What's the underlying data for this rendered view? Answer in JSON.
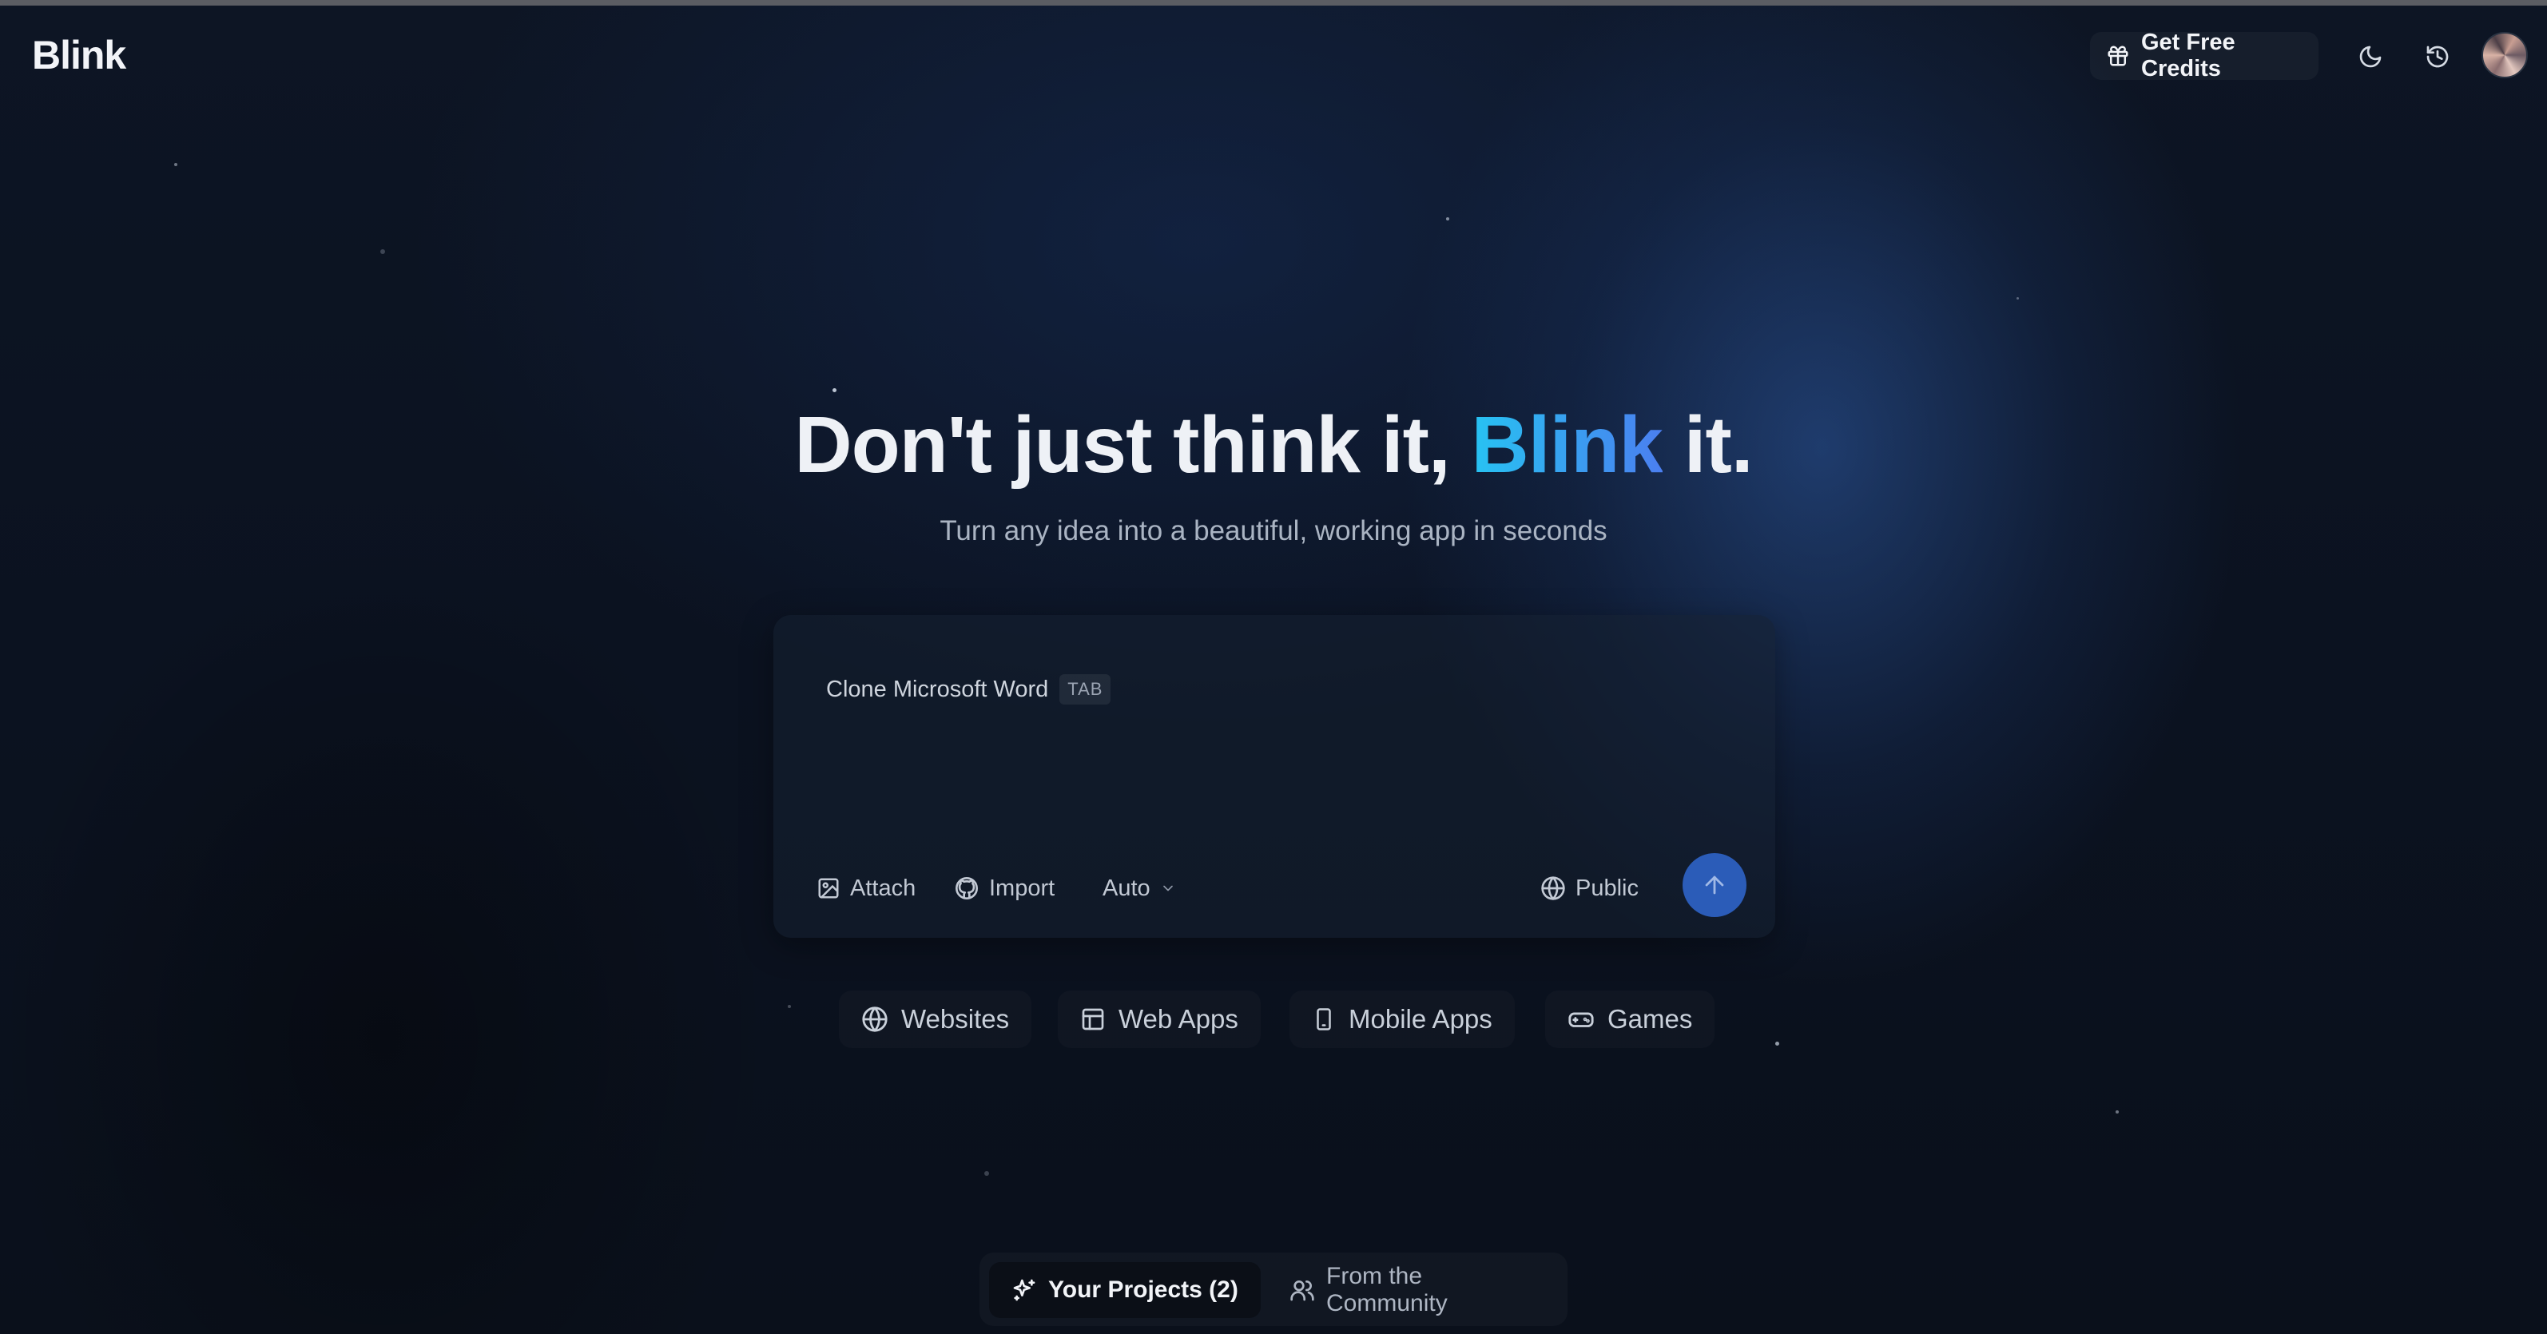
{
  "header": {
    "logo": "Blink",
    "credits_label": "Get Free Credits"
  },
  "hero": {
    "title_before": "Don't just think it, ",
    "title_brand": "Blink",
    "title_after": " it.",
    "subtitle": "Turn any idea into a beautiful, working app in seconds"
  },
  "prompt": {
    "suggestion": "Clone Microsoft Word",
    "tab_hint": "TAB",
    "attach_label": "Attach",
    "import_label": "Import",
    "model_label": "Auto",
    "visibility_label": "Public"
  },
  "categories": [
    {
      "label": "Websites",
      "icon": "globe-icon"
    },
    {
      "label": "Web Apps",
      "icon": "layout-icon"
    },
    {
      "label": "Mobile Apps",
      "icon": "smartphone-icon"
    },
    {
      "label": "Games",
      "icon": "gamepad-icon"
    }
  ],
  "bottom_tabs": {
    "your_projects": "Your Projects (2)",
    "community": "From the Community"
  },
  "colors": {
    "accent": "#2b5cb8",
    "brand_gradient_start": "#27c3f2",
    "brand_gradient_end": "#4b7ff0"
  }
}
